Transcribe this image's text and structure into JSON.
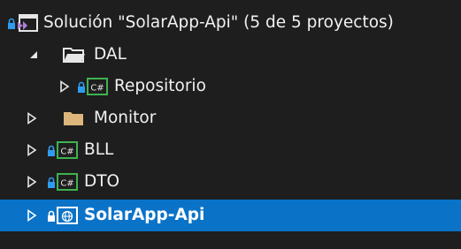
{
  "solution_explorer": {
    "solution": {
      "label": "Solución \"SolarApp-Api\" (5 de 5 proyectos)",
      "icon": "solution-icon",
      "lock_icon": "lock-icon"
    },
    "items": [
      {
        "label": "DAL",
        "icon": "solution-folder-open-icon",
        "expander": "expanded"
      },
      {
        "label": "Repositorio",
        "icon": "csharp-project-icon",
        "expander": "collapsed",
        "locked": true
      },
      {
        "label": "Monitor",
        "icon": "solution-folder-icon",
        "expander": "collapsed"
      },
      {
        "label": "BLL",
        "icon": "csharp-project-icon",
        "expander": "collapsed",
        "locked": true
      },
      {
        "label": "DTO",
        "icon": "csharp-project-icon",
        "expander": "collapsed",
        "locked": true
      },
      {
        "label": "SolarApp-Api",
        "icon": "web-project-icon",
        "expander": "collapsed",
        "locked": true,
        "selected": true
      }
    ]
  },
  "colors": {
    "background": "#1e1e1e",
    "selection": "#0a73c8",
    "text": "#f1f1f1",
    "lock": "#2e9cf0",
    "csharp_border": "#3fb24f",
    "folder": "#dcb67a"
  }
}
